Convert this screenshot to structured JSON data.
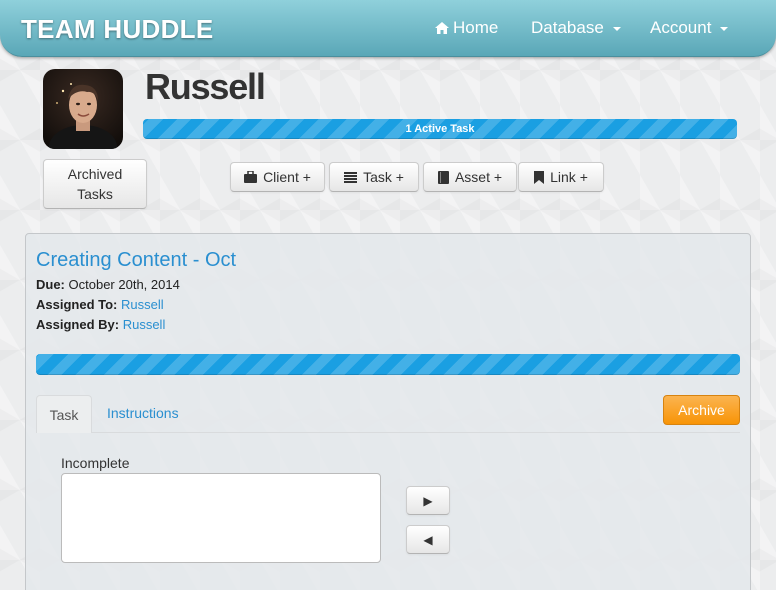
{
  "app": {
    "brand": "TEAM HUDDLE"
  },
  "nav": {
    "home": {
      "icon": "home-icon",
      "label": "Home"
    },
    "database": {
      "label": "Database"
    },
    "account": {
      "label": "Account"
    }
  },
  "profile": {
    "name": "Russell",
    "progress_label": "1 Active Task",
    "progress": 1.0,
    "archived_label_1": "Archived",
    "archived_label_2": "Tasks"
  },
  "actions": [
    {
      "icon": "briefcase-icon",
      "label": "Client +"
    },
    {
      "icon": "list-icon",
      "label": "Task +"
    },
    {
      "icon": "book-icon",
      "label": "Asset +"
    },
    {
      "icon": "bookmark-icon",
      "label": "Link +"
    }
  ],
  "task": {
    "title": "Creating Content - Oct",
    "due_label": "Due:",
    "due_value": "October 20th, 2014",
    "assigned_to_label": "Assigned To:",
    "assigned_to_value": "Russell",
    "assigned_by_label": "Assigned By:",
    "assigned_by_value": "Russell",
    "progress": 1.0
  },
  "tabs": {
    "task": "Task",
    "instructions": "Instructions",
    "archive": "Archive"
  },
  "board": {
    "incomplete_label": "Incomplete",
    "move_right_glyph": "▶",
    "move_left_glyph": "◀"
  },
  "colors": {
    "accent": "#2a8fd0",
    "progress": "#1a9fe2",
    "navbar": "#6fb8c6",
    "archive": "#f89406"
  }
}
